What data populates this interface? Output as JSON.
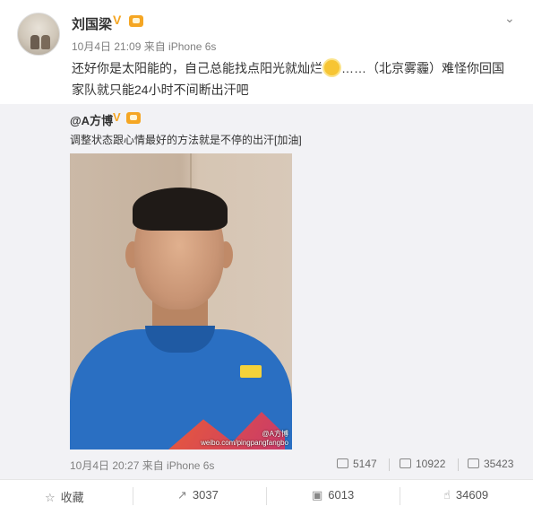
{
  "post": {
    "author": "刘国梁",
    "meta": "10月4日 21:09 来自 iPhone 6s",
    "text_line1_a": "还好你是太阳能的，自己总能找点阳光就灿烂",
    "text_line1_b": "……（北京",
    "text_line1_c": "雾霾）难怪你回国",
    "text_line2": "家队就只能24小时不间断出汗吧",
    "verified_glyph": "V"
  },
  "repost": {
    "author": "@A方博",
    "verified_glyph": "V",
    "text": "调整状态跟心情最好的方法就是不停的出汗[加油]",
    "watermark_line1": "@A方博",
    "watermark_line2": "weibo.com/pingpangfangbo",
    "meta": "10月4日 20:27 来自 iPhone 6s",
    "reposts": "5147",
    "comments": "10922",
    "likes": "35423"
  },
  "actions": {
    "favorite": "收藏",
    "repost": "3037",
    "comment": "6013",
    "like": "34609"
  },
  "icons": {
    "menu": "chevron-down-icon",
    "favorite": "star-icon",
    "repost": "share-icon",
    "comment": "comment-icon",
    "like": "thumbs-up-icon"
  },
  "colors": {
    "accent": "#f5a623",
    "repost_bg": "#f2f2f5",
    "meta": "#808080"
  }
}
